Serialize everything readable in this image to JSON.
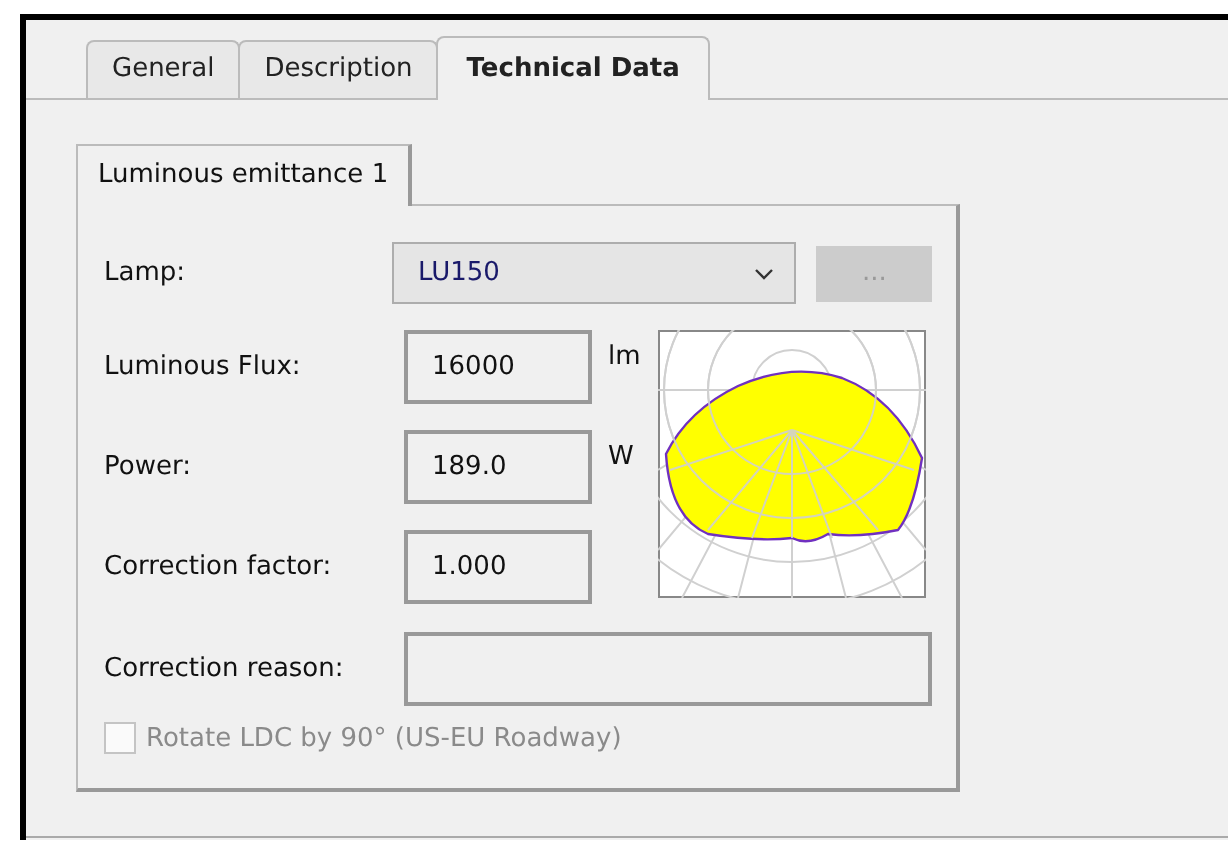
{
  "tabs": [
    {
      "label": "General",
      "selected": false
    },
    {
      "label": "Description",
      "selected": false
    },
    {
      "label": "Technical Data",
      "selected": true
    }
  ],
  "subtabs": [
    {
      "label": "Luminous emittance 1",
      "selected": true
    }
  ],
  "lamp": {
    "label": "Lamp:",
    "value": "LU150",
    "browse_button": {
      "label": "...",
      "disabled": true
    }
  },
  "fields": [
    {
      "label": "Luminous Flux:",
      "value": "16000",
      "unit": "lm"
    },
    {
      "label": "Power:",
      "value": "189.0",
      "unit": "W"
    },
    {
      "label": "Correction factor:",
      "value": "1.000"
    }
  ],
  "correction_reason": {
    "label": "Correction reason:"
  },
  "rotate_checkbox": {
    "label": "Rotate LDC by 90° (US-EU Roadway)",
    "checked": false,
    "disabled": true
  }
}
